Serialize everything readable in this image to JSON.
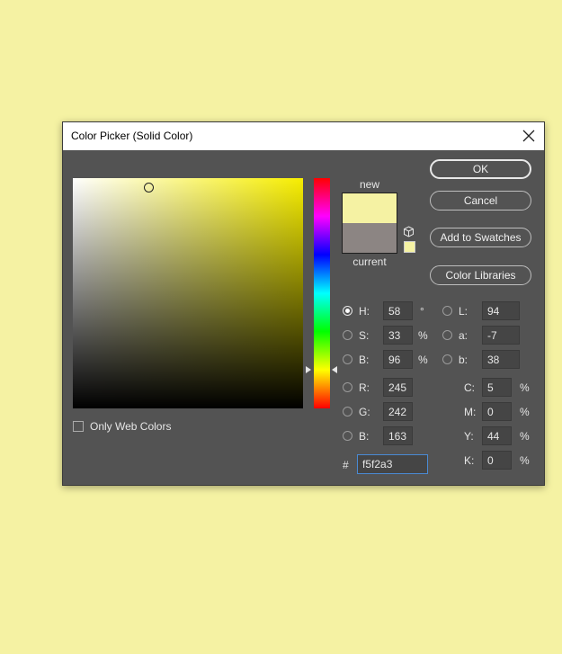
{
  "window": {
    "title": "Color Picker (Solid Color)",
    "close_icon": "close-icon"
  },
  "colors": {
    "new": "#f5f2a3",
    "current": "#8c8583",
    "hue": "#f7ee00",
    "background": "#f5f2a3"
  },
  "swatches": {
    "new_label": "new",
    "current_label": "current"
  },
  "buttons": {
    "ok": "OK",
    "cancel": "Cancel",
    "add_to_swatches": "Add to Swatches",
    "color_libraries": "Color Libraries"
  },
  "hsb": {
    "h": {
      "label": "H:",
      "value": "58",
      "unit": "°",
      "selected": true
    },
    "s": {
      "label": "S:",
      "value": "33",
      "unit": "%"
    },
    "b": {
      "label": "B:",
      "value": "96",
      "unit": "%"
    }
  },
  "rgb": {
    "r": {
      "label": "R:",
      "value": "245"
    },
    "g": {
      "label": "G:",
      "value": "242"
    },
    "b": {
      "label": "B:",
      "value": "163"
    }
  },
  "lab": {
    "l": {
      "label": "L:",
      "value": "94"
    },
    "a": {
      "label": "a:",
      "value": "-7"
    },
    "b": {
      "label": "b:",
      "value": "38"
    }
  },
  "cmyk": {
    "c": {
      "label": "C:",
      "value": "5",
      "unit": "%"
    },
    "m": {
      "label": "M:",
      "value": "0",
      "unit": "%"
    },
    "y": {
      "label": "Y:",
      "value": "44",
      "unit": "%"
    },
    "k": {
      "label": "K:",
      "value": "0",
      "unit": "%"
    }
  },
  "hex": {
    "label": "#",
    "value": "f5f2a3"
  },
  "only_web_colors": {
    "label": "Only Web Colors",
    "checked": false
  }
}
